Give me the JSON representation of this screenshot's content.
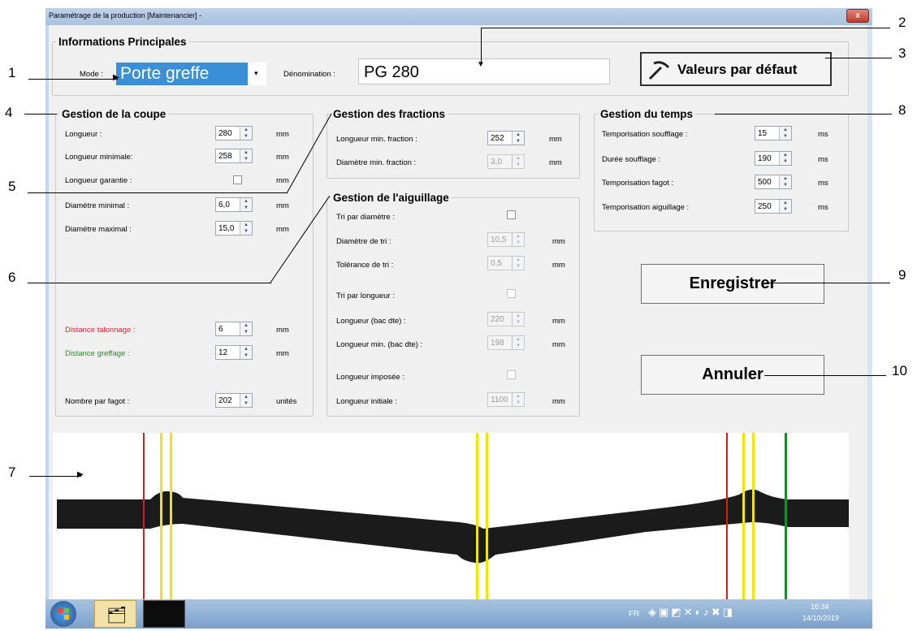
{
  "window": {
    "title": "Paramétrage de la production [Maintenancier] -",
    "close_label": "x"
  },
  "main_info": {
    "legend": "Informations Principales",
    "mode_label": "Mode :",
    "mode_value": "Porte greffe",
    "denomination_label": "Dénomination :",
    "denomination_value": "PG 280",
    "defaults_button": "Valeurs par défaut"
  },
  "coupe": {
    "legend": "Gestion de la coupe",
    "longueur": {
      "label": "Longueur :",
      "value": "280",
      "unit": "mm"
    },
    "longueur_min": {
      "label": "Longueur minimale:",
      "value": "258",
      "unit": "mm"
    },
    "longueur_garantie": {
      "label": "Longueur garantie :",
      "unit": "mm"
    },
    "diametre_min": {
      "label": "Diamètre minimal :",
      "value": "6,0",
      "unit": "mm"
    },
    "diametre_max": {
      "label": "Diamètre maximal :",
      "value": "15,0",
      "unit": "mm"
    },
    "distance_talonnage": {
      "label": "Distance talonnage :",
      "value": "6",
      "unit": "mm"
    },
    "distance_greffage": {
      "label": "Distance greffage :",
      "value": "12",
      "unit": "mm"
    },
    "nombre_fagot": {
      "label": "Nombre par fagot :",
      "value": "202",
      "unit": "unités"
    }
  },
  "fractions": {
    "legend": "Gestion des fractions",
    "longueur_min": {
      "label": "Longueur min. fraction :",
      "value": "252",
      "unit": "mm"
    },
    "diametre_min": {
      "label": "Diamètre min. fraction :",
      "value": "3,0",
      "unit": "mm"
    }
  },
  "aiguillage": {
    "legend": "Gestion de l'aiguillage",
    "tri_diametre": {
      "label": "Tri par diamètre :"
    },
    "diametre_tri": {
      "label": "Diamètre de tri :",
      "value": "10,5",
      "unit": "mm"
    },
    "tolerance_tri": {
      "label": "Tolérance de tri :",
      "value": "0,5",
      "unit": "mm"
    },
    "tri_longueur": {
      "label": "Tri par longueur :"
    },
    "longueur_bac": {
      "label": "Longueur (bac dte) :",
      "value": "220",
      "unit": "mm"
    },
    "longueur_min_bac": {
      "label": "Longueur min. (bac dte) :",
      "value": "198",
      "unit": "mm"
    },
    "longueur_imposee": {
      "label": "Longueur imposée :"
    },
    "longueur_initiale": {
      "label": "Longueur initiale :",
      "value": "1100",
      "unit": "mm"
    }
  },
  "temps": {
    "legend": "Gestion du temps",
    "tempo_soufflage": {
      "label": "Temporisation soufflage :",
      "value": "15",
      "unit": "ms"
    },
    "duree_soufflage": {
      "label": "Durée soufflage :",
      "value": "190",
      "unit": "ms"
    },
    "tempo_fagot": {
      "label": "Temporisation fagot :",
      "value": "500",
      "unit": "ms"
    },
    "tempo_aiguillage": {
      "label": "Temporisation aiguillage :",
      "value": "250",
      "unit": "ms"
    }
  },
  "buttons": {
    "save": "Enregistrer",
    "cancel": "Annuler"
  },
  "taskbar": {
    "lang": "FR",
    "time": "16:34",
    "date": "14/10/2019"
  },
  "callouts": [
    "1",
    "2",
    "3",
    "4",
    "5",
    "6",
    "7",
    "8",
    "9",
    "10"
  ],
  "colors": {
    "talonnage": "#e0202a",
    "greffage": "#2a8a2a",
    "red_line": "#d81b1b",
    "yellow_line": "#f2e600",
    "green_line": "#1e8a2e"
  }
}
